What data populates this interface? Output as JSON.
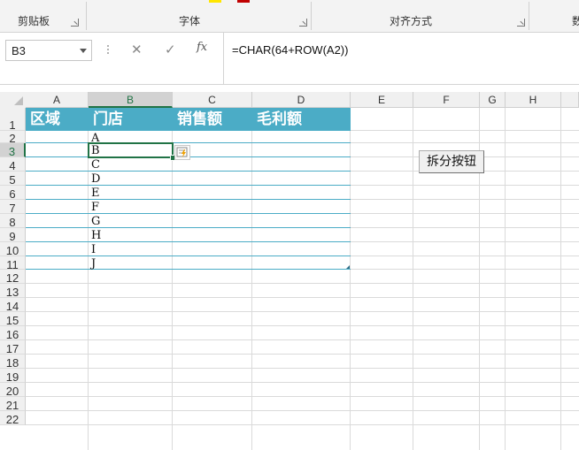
{
  "ribbon": {
    "groups": [
      {
        "label": "剪贴板"
      },
      {
        "label": "字体"
      },
      {
        "label": "对齐方式"
      },
      {
        "label": "数"
      }
    ],
    "font_color_accent": "#ffe600",
    "fill_color_accent": "#c00000"
  },
  "formula_bar": {
    "name_box": "B3",
    "cancel_glyph": "✕",
    "enter_glyph": "✓",
    "fx_label": "fx",
    "formula": "=CHAR(64+ROW(A2))"
  },
  "sheet": {
    "columns": [
      "A",
      "B",
      "C",
      "D",
      "E",
      "F",
      "G",
      "H"
    ],
    "selected_column": "B",
    "rows": [
      "1",
      "2",
      "3",
      "4",
      "5",
      "6",
      "7",
      "8",
      "9",
      "10",
      "11",
      "12",
      "13",
      "14",
      "15",
      "16",
      "17",
      "18",
      "19",
      "20",
      "21",
      "22"
    ],
    "selected_row": "3",
    "table_headers": [
      "区域",
      "门店",
      "销售额",
      "毛利额"
    ],
    "store_values": [
      "A",
      "B",
      "C",
      "D",
      "E",
      "F",
      "G",
      "H",
      "I",
      "J"
    ],
    "header_fill": "#4bacc6",
    "selection_color": "#217346",
    "button_label": "拆分按钮"
  }
}
